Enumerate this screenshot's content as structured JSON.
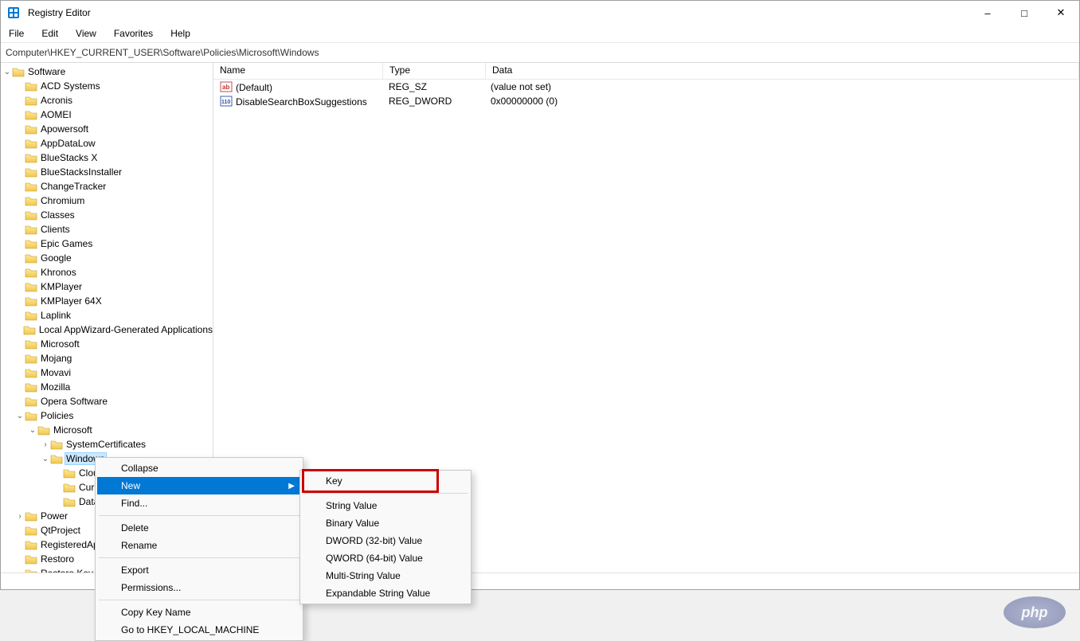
{
  "window": {
    "title": "Registry Editor"
  },
  "menubar": {
    "file": "File",
    "edit": "Edit",
    "view": "View",
    "favorites": "Favorites",
    "help": "Help"
  },
  "addressbar": {
    "path": "Computer\\HKEY_CURRENT_USER\\Software\\Policies\\Microsoft\\Windows"
  },
  "tree": {
    "root": "Software",
    "items": [
      "ACD Systems",
      "Acronis",
      "AOMEI",
      "Apowersoft",
      "AppDataLow",
      "BlueStacks X",
      "BlueStacksInstaller",
      "ChangeTracker",
      "Chromium",
      "Classes",
      "Clients",
      "Epic Games",
      "Google",
      "Khronos",
      "KMPlayer",
      "KMPlayer 64X",
      "Laplink",
      "Local AppWizard-Generated Applications",
      "Microsoft",
      "Mojang",
      "Movavi",
      "Mozilla",
      "Opera Software"
    ],
    "policies": {
      "label": "Policies",
      "microsoft": {
        "label": "Microsoft",
        "system_certs": "SystemCertificates",
        "windows": {
          "label": "Windows",
          "children": [
            "Cloud",
            "Curre",
            "DataC"
          ]
        }
      }
    },
    "items_after": [
      "Power",
      "QtProject",
      "RegisteredAppl",
      "Restoro",
      "Restoro Key"
    ]
  },
  "values": {
    "headers": {
      "name": "Name",
      "type": "Type",
      "data": "Data"
    },
    "rows": [
      {
        "name": "(Default)",
        "type": "REG_SZ",
        "data": "(value not set)",
        "kind": "string"
      },
      {
        "name": "DisableSearchBoxSuggestions",
        "type": "REG_DWORD",
        "data": "0x00000000 (0)",
        "kind": "dword"
      }
    ]
  },
  "context_menu": {
    "collapse": "Collapse",
    "new": "New",
    "find": "Find...",
    "delete": "Delete",
    "rename": "Rename",
    "export": "Export",
    "permissions": "Permissions...",
    "copy_key": "Copy Key Name",
    "goto": "Go to HKEY_LOCAL_MACHINE"
  },
  "submenu": {
    "key": "Key",
    "string": "String Value",
    "binary": "Binary Value",
    "dword": "DWORD (32-bit) Value",
    "qword": "QWORD (64-bit) Value",
    "multi": "Multi-String Value",
    "expand": "Expandable String Value"
  },
  "watermark": "php"
}
